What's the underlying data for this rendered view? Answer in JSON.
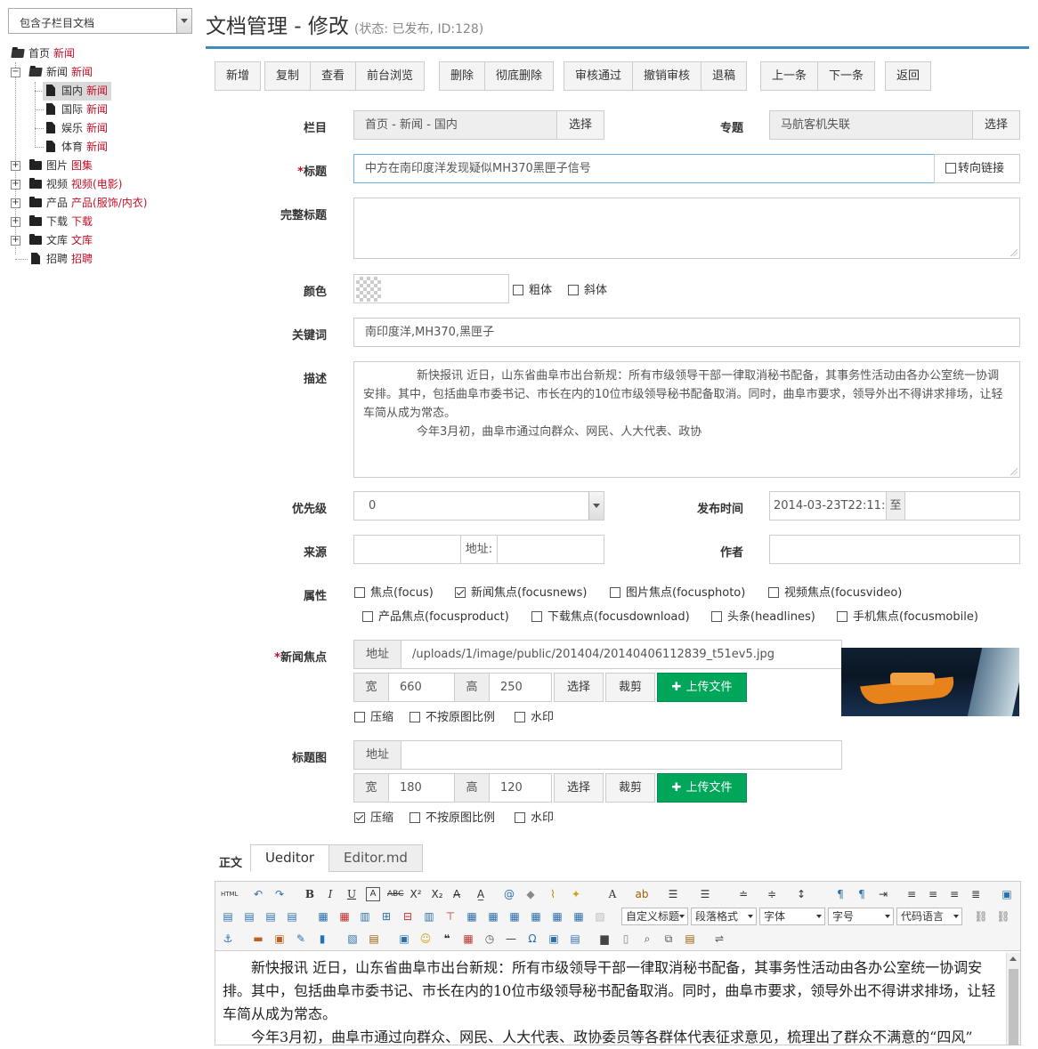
{
  "sidebar": {
    "select_value": "包含子栏目文档",
    "tree": [
      {
        "label": "首页",
        "tag": "新闻"
      },
      {
        "label": "新闻",
        "tag": "新闻"
      },
      {
        "label": "国内",
        "tag": "新闻"
      },
      {
        "label": "国际",
        "tag": "新闻"
      },
      {
        "label": "娱乐",
        "tag": "新闻"
      },
      {
        "label": "体育",
        "tag": "新闻"
      },
      {
        "label": "图片",
        "tag": "图集"
      },
      {
        "label": "视频",
        "tag": "视频(电影)"
      },
      {
        "label": "产品",
        "tag": "产品(服饰/内衣)"
      },
      {
        "label": "下载",
        "tag": "下载"
      },
      {
        "label": "文库",
        "tag": "文库"
      },
      {
        "label": "招聘",
        "tag": "招聘"
      }
    ]
  },
  "header": {
    "title": "文档管理 - 修改",
    "status": "(状态: 已发布, ID:128)"
  },
  "toolbar": {
    "g1": [
      "新增",
      "复制",
      "查看",
      "前台浏览"
    ],
    "g2": [
      "删除",
      "彻底删除"
    ],
    "g3": [
      "审核通过",
      "撤销审核",
      "退稿"
    ],
    "g4": [
      "上一条",
      "下一条"
    ],
    "g5": [
      "返回"
    ]
  },
  "form": {
    "node_label": "栏目",
    "node_value": "首页 - 新闻 - 国内",
    "select_btn": "选择",
    "special_label": "专题",
    "special_value": "马航客机失联",
    "title_label": "标题",
    "title_required": "*",
    "title_value": "中方在南印度洋发现疑似MH370黑匣子信号",
    "link_label": "转向链接",
    "full_title_label": "完整标题",
    "color_label": "颜色",
    "bold_label": "粗体",
    "italic_label": "斜体",
    "keywords_label": "关键词",
    "keywords_value": "南印度洋,MH370,黑匣子",
    "desc_label": "描述",
    "desc_p1": "新快报讯 近日，山东省曲阜市出台新规：所有市级领导干部一律取消秘书配备，其事务性活动由各办公室统一协调安排。其中，包括曲阜市委书记、市长在内的10位市级领导秘书配备取消。同时，曲阜市要求，领导外出不得讲求排场，让轻车简从成为常态。",
    "desc_p2": "今年3月初，曲阜市通过向群众、网民、人大代表、政协",
    "priority_label": "优先级",
    "priority_value": "0",
    "pubdate_label": "发布时间",
    "pubdate_value": "2014-03-23T22:11:",
    "to_label": "至",
    "source_label": "来源",
    "address_label": "地址:",
    "author_label": "作者",
    "attr_label": "属性",
    "attrs": [
      {
        "label": "焦点(focus)",
        "checked": false
      },
      {
        "label": "新闻焦点(focusnews)",
        "checked": true
      },
      {
        "label": "图片焦点(focusphoto)",
        "checked": false
      },
      {
        "label": "视频焦点(focusvideo)",
        "checked": false
      },
      {
        "label": "产品焦点(focusproduct)",
        "checked": false
      },
      {
        "label": "下载焦点(focusdownload)",
        "checked": false
      },
      {
        "label": "头条(headlines)",
        "checked": false
      },
      {
        "label": "手机焦点(focusmobile)",
        "checked": false
      }
    ],
    "focus_label": "新闻焦点",
    "focus_required": "*",
    "addr_addon": "地址",
    "focus_path": "/uploads/1/image/public/201404/20140406112839_t51ev5.jpg",
    "width_addon": "宽",
    "height_addon": "高",
    "focus_width": "660",
    "focus_height": "250",
    "crop_btn": "裁剪",
    "upload_btn": "上传文件",
    "compress_label": "压缩",
    "ratio_label": "不按原图比例",
    "watermark_label": "水印",
    "thumb_label": "标题图",
    "thumb_width": "180",
    "thumb_height": "120",
    "body_label": "正文",
    "tab_ueditor": "Ueditor",
    "tab_editormd": "Editor.md"
  },
  "editor": {
    "dd_title": "自定义标题",
    "dd_para": "段落格式",
    "dd_font": "字体",
    "dd_size": "字号",
    "dd_code": "代码语言",
    "p1": "新快报讯 近日，山东省曲阜市出台新规：所有市级领导干部一律取消秘书配备，其事务性活动由各办公室统一协调安排。其中，包括曲阜市委书记、市长在内的10位市级领导秘书配备取消。同时，曲阜市要求，领导外出不得讲求排场，让轻车简从成为常态。",
    "p2": "今年3月初，曲阜市通过向群众、网民、人大代表、政协委员等各群体代表征求意见，梳理出了群众不满意的“四风”"
  }
}
